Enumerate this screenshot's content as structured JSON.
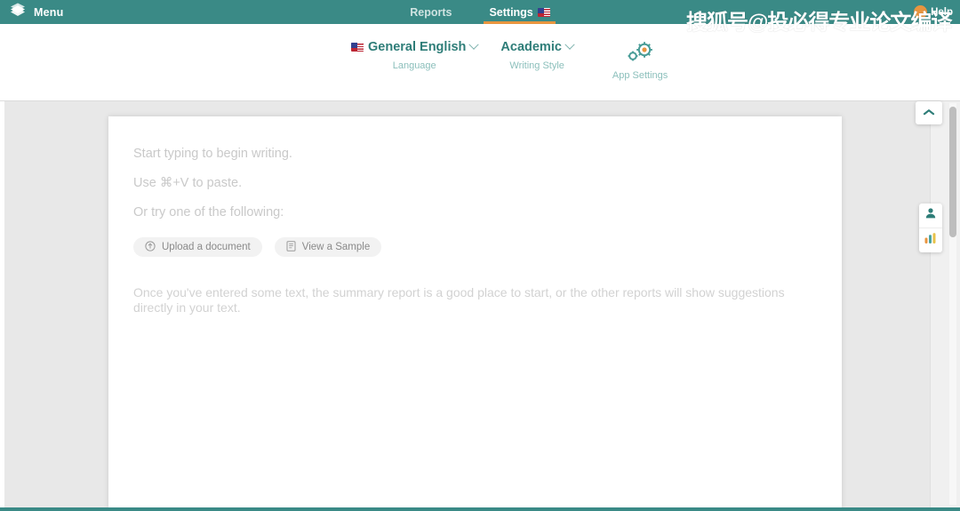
{
  "header": {
    "menu_label": "Menu",
    "logo_icon": "stacked-layers-icon",
    "nav": [
      {
        "label": "Reports",
        "active": false
      },
      {
        "label": "Settings",
        "active": true,
        "flag": "us-flag-icon"
      }
    ],
    "help_label": "Help",
    "help_icon": "help-circle-icon"
  },
  "watermark": {
    "text": "搜狐号@投必得专业论文编译"
  },
  "settings_bar": {
    "language": {
      "value": "General English",
      "label": "Language",
      "flag": "us-flag-icon",
      "caret": "chevron-down-icon"
    },
    "writing_style": {
      "value": "Academic",
      "label": "Writing Style",
      "caret": "chevron-down-icon"
    },
    "app_settings": {
      "label": "App Settings",
      "icon": "gears-icon"
    }
  },
  "editor": {
    "hints": [
      "Start typing to begin writing.",
      "Use ⌘+V to paste.",
      "Or try one of the following:"
    ],
    "buttons": [
      {
        "label": "Upload a document",
        "icon": "upload-circle-icon"
      },
      {
        "label": "View a Sample",
        "icon": "document-icon"
      }
    ],
    "note": "Once you've entered some text, the summary report is a good place to start, or the other reports will show suggestions directly in your text."
  },
  "right_rail": {
    "collapse_icon": "chevron-up-icon",
    "tiles": [
      {
        "icon": "person-icon"
      },
      {
        "icon": "bar-chart-icon"
      }
    ]
  },
  "colors": {
    "teal": "#3a8a86",
    "teal_text": "#2e7d78",
    "teal_light": "#8bbfbb",
    "orange": "#e8953f",
    "panel_bg": "#e8e8e8",
    "hint_gray": "#c9c9c9"
  }
}
